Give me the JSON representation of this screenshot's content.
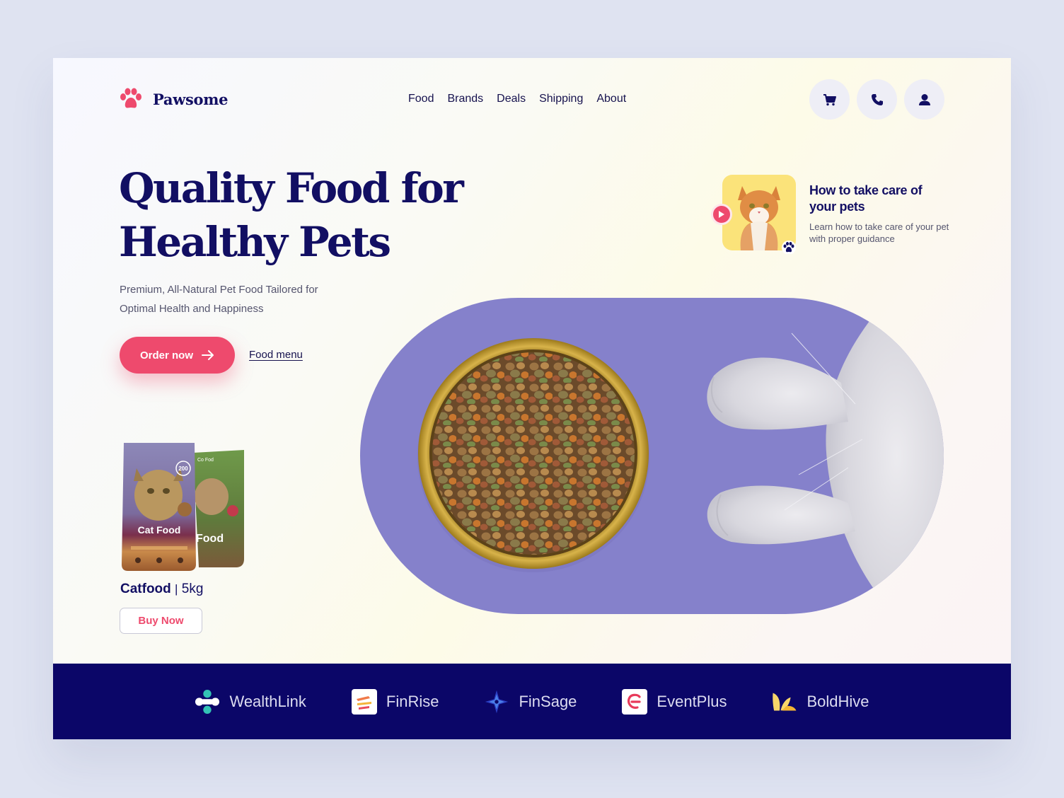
{
  "brand": {
    "name": "Pawsome",
    "accent": "#ee4a6d",
    "navy": "#120f63"
  },
  "nav": {
    "items": [
      "Food",
      "Brands",
      "Deals",
      "Shipping",
      "About"
    ]
  },
  "header_icons": [
    "cart-icon",
    "phone-icon",
    "user-icon"
  ],
  "hero": {
    "title_line1": "Quality Food for",
    "title_line2": "Healthy Pets",
    "subtitle": "Premium, All-Natural Pet Food Tailored for Optimal Health and Happiness",
    "order_label": "Order now",
    "menu_label": "Food menu"
  },
  "product": {
    "pack_front_label": "Cat Food",
    "pack_back_label": "Food",
    "pack_back_top": "Co Fod",
    "pack_badge": "200",
    "name": "Catfood",
    "separator": "|",
    "weight": "5kg",
    "buy_label": "Buy Now"
  },
  "guide": {
    "title": "How to take care of your pets",
    "description": "Learn how to take care of your pet with proper guidance"
  },
  "partners": [
    {
      "name": "WealthLink",
      "icon": "wealthlink-logo-icon"
    },
    {
      "name": "FinRise",
      "icon": "finrise-logo-icon"
    },
    {
      "name": "FinSage",
      "icon": "finsage-logo-icon"
    },
    {
      "name": "EventPlus",
      "icon": "eventplus-logo-icon"
    },
    {
      "name": "BoldHive",
      "icon": "boldhive-logo-icon"
    }
  ]
}
